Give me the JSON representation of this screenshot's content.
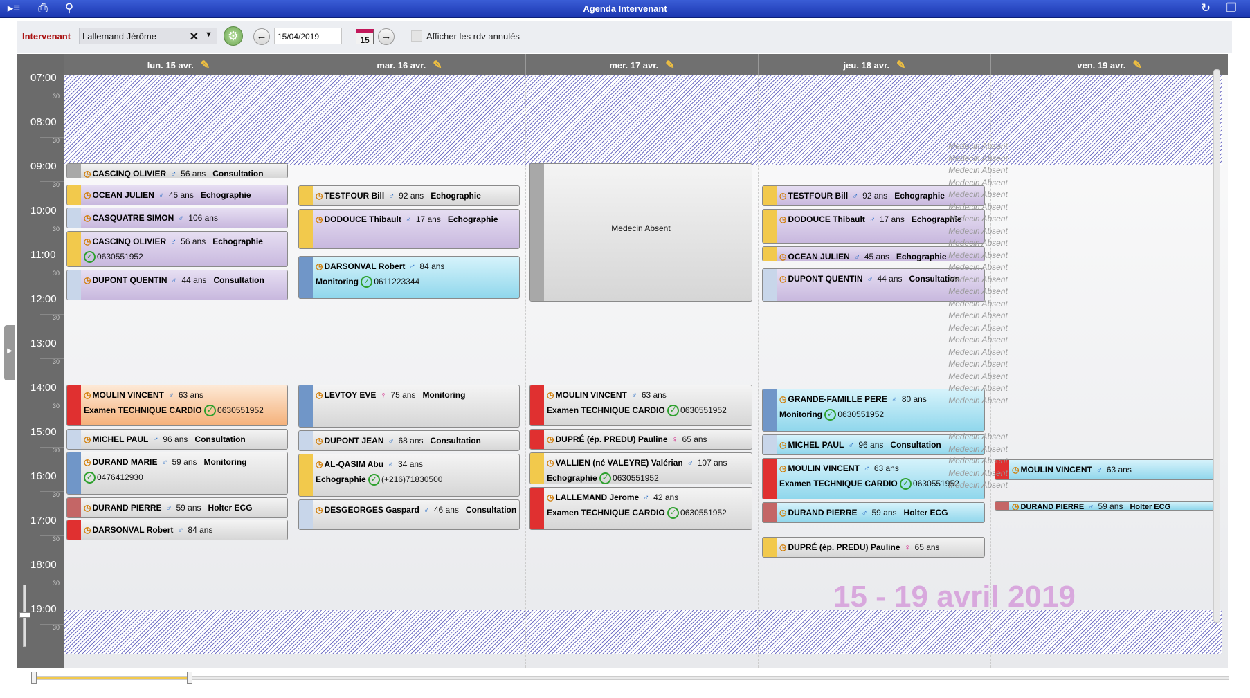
{
  "window": {
    "title": "Agenda Intervenant"
  },
  "toolbar": {
    "intervenant_label": "Intervenant",
    "intervenant_value": "Lallemand Jérôme",
    "date_value": "15/04/2019",
    "calendar_day": "15",
    "show_cancelled_label": "Afficher les rdv annulés",
    "show_cancelled_checked": false
  },
  "days": [
    {
      "label": "lun. 15 avr."
    },
    {
      "label": "mar. 16 avr."
    },
    {
      "label": "mer. 17 avr."
    },
    {
      "label": "jeu. 18 avr."
    },
    {
      "label": "ven. 19 avr."
    }
  ],
  "hours": [
    "07:00",
    "08:00",
    "09:00",
    "10:00",
    "11:00",
    "12:00",
    "13:00",
    "14:00",
    "15:00",
    "16:00",
    "17:00",
    "18:00",
    "19:00"
  ],
  "half_label": "30",
  "colors": {
    "purple": "#c8b8de",
    "cyan": "#90d7ec",
    "orange": "#f5b17a",
    "gray": "#d6d6d6",
    "hatch": "#7272c6"
  },
  "events": {
    "mon": [
      {
        "name": "CASCINQ OLIVIER",
        "sex": "♂",
        "age": "56 ans",
        "type": "Consultation"
      },
      {
        "name": "OCEAN JULIEN",
        "sex": "♂",
        "age": "45 ans",
        "type": "Echographie"
      },
      {
        "name": "CASQUATRE SIMON",
        "sex": "♂",
        "age": "106 ans"
      },
      {
        "name": "CASCINQ OLIVIER",
        "sex": "♂",
        "age": "56 ans",
        "type": "Echographie",
        "phone": "0630551952"
      },
      {
        "name": "DUPONT QUENTIN",
        "sex": "♂",
        "age": "44 ans",
        "type": "Consultation"
      },
      {
        "name": "MOULIN VINCENT",
        "sex": "♂",
        "age": "63 ans",
        "type": "Examen TECHNIQUE CARDIO",
        "phone": "0630551952"
      },
      {
        "name": "MICHEL PAUL",
        "sex": "♂",
        "age": "96 ans",
        "type": "Consultation"
      },
      {
        "name": "DURAND MARIE",
        "sex": "♂",
        "age": "59 ans",
        "type": "Monitoring",
        "phone": "0476412930"
      },
      {
        "name": "DURAND PIERRE",
        "sex": "♂",
        "age": "59 ans",
        "type": "Holter ECG"
      },
      {
        "name": "DARSONVAL Robert",
        "sex": "♂",
        "age": "84 ans"
      }
    ],
    "tue": [
      {
        "name": "TESTFOUR Bill",
        "sex": "♂",
        "age": "92 ans",
        "type": "Echographie"
      },
      {
        "name": "DODOUCE Thibault",
        "sex": "♂",
        "age": "17 ans",
        "type": "Echographie"
      },
      {
        "name": "DARSONVAL Robert",
        "sex": "♂",
        "age": "84 ans",
        "type": "Monitoring",
        "phone": "0611223344"
      },
      {
        "name": "LEVTOY EVE",
        "sex": "♀",
        "age": "75 ans",
        "type": "Monitoring"
      },
      {
        "name": "DUPONT JEAN",
        "sex": "♂",
        "age": "68 ans",
        "type": "Consultation"
      },
      {
        "name": "AL-QASIM Abu",
        "sex": "♂",
        "age": "34 ans",
        "type": "Echographie",
        "phone": "(+216)71830500"
      },
      {
        "name": "DESGEORGES Gaspard",
        "sex": "♂",
        "age": "46 ans",
        "type": "Consultation"
      }
    ],
    "wed": [
      {
        "label": "Medecin Absent"
      },
      {
        "name": "MOULIN VINCENT",
        "sex": "♂",
        "age": "63 ans",
        "type": "Examen TECHNIQUE CARDIO",
        "phone": "0630551952"
      },
      {
        "name": "DUPRÉ (ép. PREDU) Pauline",
        "sex": "♀",
        "age": "65 ans"
      },
      {
        "name": "VALLIEN (né VALEYRE) Valérian",
        "sex": "♂",
        "age": "107 ans",
        "type": "Echographie",
        "phone": "0630551952"
      },
      {
        "name": "LALLEMAND Jerome",
        "sex": "♂",
        "age": "42 ans",
        "type": "Examen TECHNIQUE CARDIO",
        "phone": "0630551952"
      }
    ],
    "thu": [
      {
        "name": "TESTFOUR Bill",
        "sex": "♂",
        "age": "92 ans",
        "type": "Echographie"
      },
      {
        "name": "DODOUCE Thibault",
        "sex": "♂",
        "age": "17 ans",
        "type": "Echographie"
      },
      {
        "name": "OCEAN JULIEN",
        "sex": "♂",
        "age": "45 ans",
        "type": "Echographie"
      },
      {
        "name": "DUPONT QUENTIN",
        "sex": "♂",
        "age": "44 ans",
        "type": "Consultation"
      },
      {
        "name": "GRANDE-FAMILLE PERE",
        "sex": "♂",
        "age": "80 ans",
        "type": "Monitoring",
        "phone": "0630551952"
      },
      {
        "name": "MICHEL PAUL",
        "sex": "♂",
        "age": "96 ans",
        "type": "Consultation"
      },
      {
        "name": "MOULIN VINCENT",
        "sex": "♂",
        "age": "63 ans",
        "type": "Examen TECHNIQUE CARDIO",
        "phone": "0630551952"
      },
      {
        "name": "DURAND PIERRE",
        "sex": "♂",
        "age": "59 ans",
        "type": "Holter ECG"
      },
      {
        "name": "DUPRÉ (ép. PREDU) Pauline",
        "sex": "♀",
        "age": "65 ans"
      }
    ],
    "fri": [
      {
        "name": "MOULIN VINCENT",
        "sex": "♂",
        "age": "63 ans"
      },
      {
        "name": "DURAND PIERRE",
        "sex": "♂",
        "age": "59 ans",
        "type": "Holter ECG"
      }
    ]
  },
  "absent_label": "Medecin Absent",
  "watermark": "15 - 19 avril 2019"
}
